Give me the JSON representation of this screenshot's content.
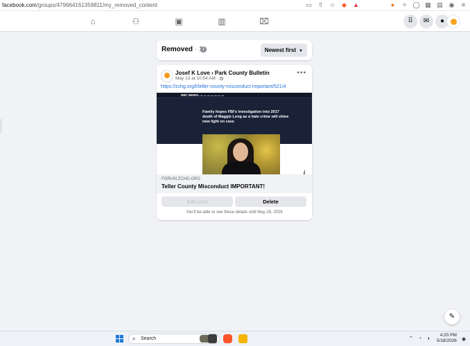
{
  "browser": {
    "url_host": "facebook.com",
    "url_path": "/groups/479664161359811/my_removed_content"
  },
  "header": {
    "title": "Removed",
    "count": "· 1",
    "sort_label": "Newest first"
  },
  "post": {
    "author": "Josef K Love › Park County Bulletin",
    "timestamp": "May 13 at 10:54 AM ·",
    "link": "https://zchg.org/t/teller-county-misconduct-important/521/4",
    "preview": {
      "headline": "Family hopes FBI's investigation into 2017 death of Maggie Long as a hate crime will shine new light on case",
      "logo": "NBC NEWS",
      "domain": "FORUM.ZCHG.ORG",
      "title": "Teller County Misconduct IMPORTANT!"
    },
    "edit_label": "Edit post",
    "delete_label": "Delete",
    "notice": "You'll be able to see these details until May 28, 2026"
  },
  "taskbar": {
    "search_placeholder": "Search",
    "time": "4:20 PM",
    "date": "5/18/2026"
  },
  "colors": {
    "link": "#216fdb",
    "background": "#f0f2f5",
    "nbc_navy": "#1a2238"
  }
}
